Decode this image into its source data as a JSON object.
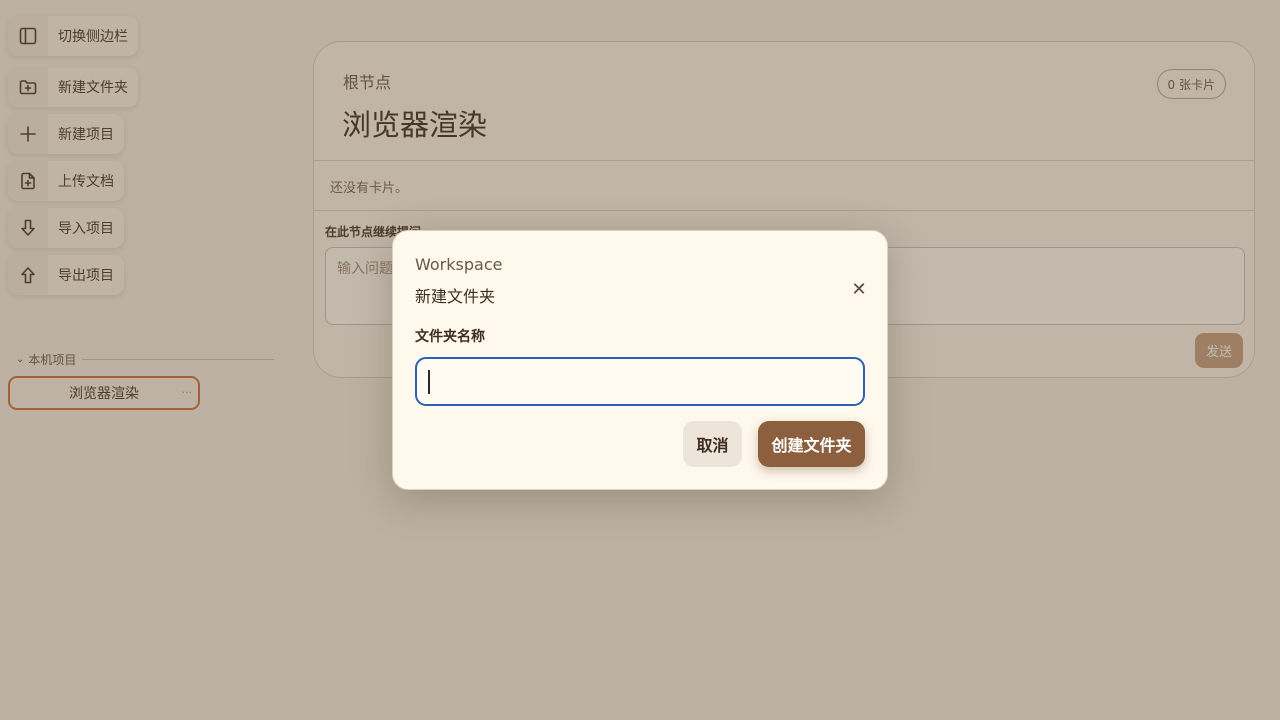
{
  "sidebar": {
    "tools": [
      {
        "label": "切换侧边栏",
        "icon": "sidebar-toggle-icon"
      },
      {
        "label": "新建文件夹",
        "icon": "folder-plus-icon"
      },
      {
        "label": "新建项目",
        "icon": "plus-icon"
      },
      {
        "label": "上传文档",
        "icon": "file-plus-icon"
      },
      {
        "label": "导入项目",
        "icon": "arrow-down-icon"
      },
      {
        "label": "导出项目",
        "icon": "arrow-up-icon"
      }
    ],
    "section_title": "本机项目",
    "projects": [
      {
        "label": "浏览器渲染",
        "more": "···"
      }
    ]
  },
  "main": {
    "breadcrumb": "根节点",
    "title": "浏览器渲染",
    "card_count": "0 张卡片",
    "empty_text": "还没有卡片。",
    "ask_label": "在此节点继续提问",
    "ask_placeholder": "输入问题...",
    "send_label": "发送"
  },
  "modal": {
    "eyebrow": "Workspace",
    "title": "新建文件夹",
    "close_glyph": "✕",
    "field_label": "文件夹名称",
    "field_value": "",
    "cancel_label": "取消",
    "create_label": "创建文件夹"
  },
  "colors": {
    "accent": "#8c5f3e",
    "focus_ring": "#2f5fb5",
    "selected_border": "#d2703f"
  }
}
